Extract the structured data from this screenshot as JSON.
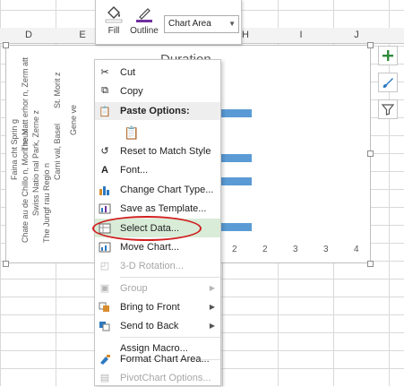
{
  "columns": [
    "D",
    "E",
    "H",
    "I",
    "J"
  ],
  "ribbon": {
    "fill_label": "Fill",
    "outline_label": "Outline",
    "area_value": "Chart Area"
  },
  "chart": {
    "title_partial": "Duration",
    "y_labels": [
      "St. Morit z",
      "The Matt erhor n, Zerm att",
      "Gene ve",
      "Carni val, Basel",
      "Faina cht Sprin g",
      "Swiss Natio nal Park, Zerne z",
      "Chate au de Chillo n, Mont reux",
      "The Jungf rau Regio n"
    ],
    "x_ticks": [
      "2",
      "2",
      "3",
      "3",
      "4"
    ]
  },
  "chart_data": {
    "type": "bar",
    "categories": [
      "St. Moritz",
      "The Matterhorn, Zermatt",
      "Geneve",
      "Carnival, Basel",
      "Fainacht Spring",
      "Swiss National Park, Zernez",
      "Chateau de Chillon, Montreux",
      "The Jungfrau Region"
    ],
    "values": [
      2,
      3,
      2,
      3,
      3,
      null,
      3,
      null
    ],
    "xlim": [
      0,
      4
    ],
    "title": "Duration"
  },
  "menu": {
    "items": [
      {
        "label": "Cut",
        "icon": "scissors-icon",
        "disabled": false
      },
      {
        "label": "Copy",
        "icon": "copy-icon",
        "disabled": false
      },
      {
        "label": "Paste Options:",
        "icon": "paste-icon",
        "disabled": false
      },
      {
        "label": "Reset to Match Style",
        "icon": "reset-style-icon",
        "disabled": false
      },
      {
        "label": "Font...",
        "icon": "font-icon",
        "disabled": false
      },
      {
        "label": "Change Chart Type...",
        "icon": "chart-type-icon",
        "disabled": false
      },
      {
        "label": "Save as Template...",
        "icon": "template-icon",
        "disabled": false
      },
      {
        "label": "Select Data...",
        "icon": "select-data-icon",
        "disabled": false
      },
      {
        "label": "Move Chart...",
        "icon": "move-chart-icon",
        "disabled": false
      },
      {
        "label": "3-D Rotation...",
        "icon": "rotation-icon",
        "disabled": true
      },
      {
        "label": "Group",
        "icon": "group-icon",
        "disabled": true
      },
      {
        "label": "Bring to Front",
        "icon": "bring-front-icon",
        "disabled": false
      },
      {
        "label": "Send to Back",
        "icon": "send-back-icon",
        "disabled": false
      },
      {
        "label": "Assign Macro...",
        "icon": "",
        "disabled": false
      },
      {
        "label": "Format Chart Area...",
        "icon": "format-icon",
        "disabled": false
      },
      {
        "label": "PivotChart Options...",
        "icon": "pivot-icon",
        "disabled": true
      }
    ]
  },
  "colors": {
    "bar": "#5b9bd5",
    "highlight": "#d8ecd8",
    "circle": "#d11f1f"
  }
}
